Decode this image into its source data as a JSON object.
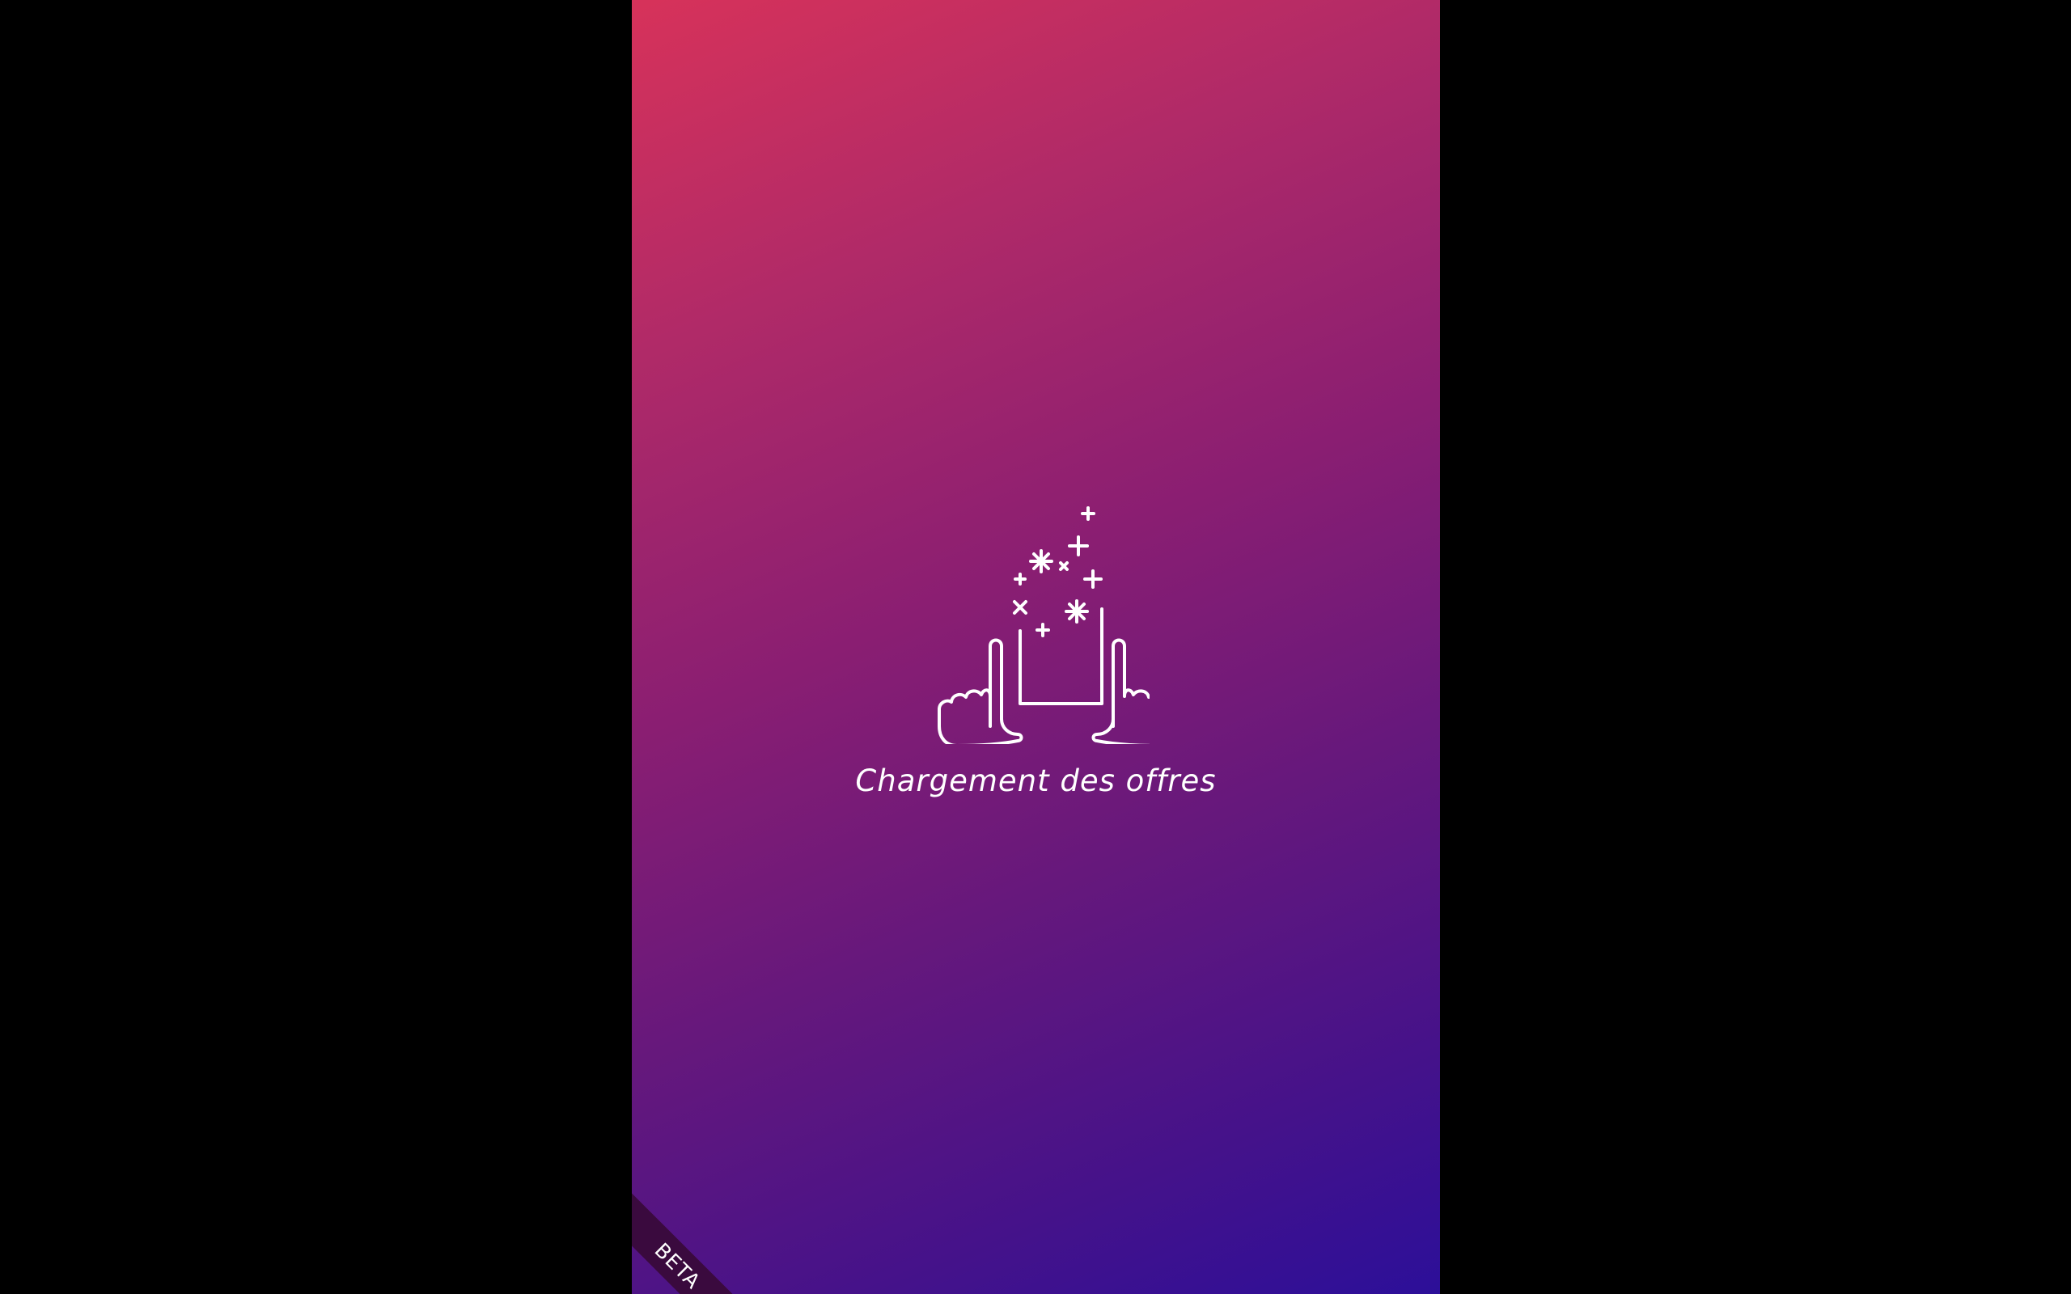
{
  "loader": {
    "message": "Chargement des offres",
    "icon": "hands-framing-sparkles-icon"
  },
  "badge": {
    "label": "BETA"
  },
  "colors": {
    "gradient_start": "#d7325a",
    "gradient_end": "#2c0f99",
    "outside_background": "#000000",
    "ribbon": "#3a0a3e",
    "foreground": "#ffffff"
  }
}
